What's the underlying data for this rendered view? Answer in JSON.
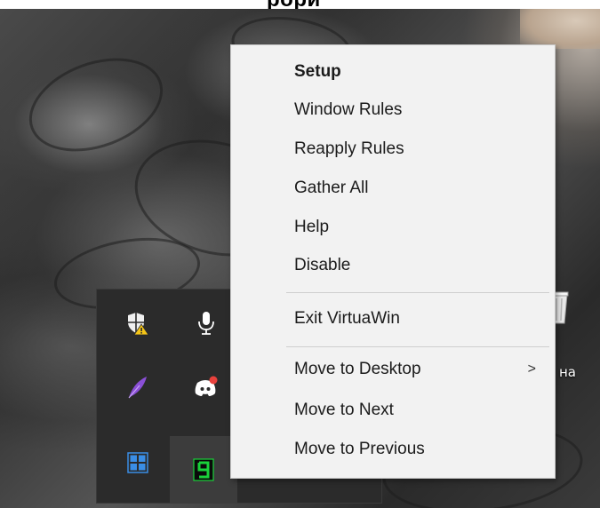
{
  "header": {
    "title_fragment": "рори"
  },
  "menu": {
    "items": [
      {
        "label": "Setup",
        "bold": true
      },
      {
        "label": "Window Rules"
      },
      {
        "label": "Reapply Rules"
      },
      {
        "label": "Gather All"
      },
      {
        "label": "Help"
      },
      {
        "label": "Disable"
      }
    ],
    "exit_label": "Exit VirtuaWin",
    "move_items": [
      {
        "label": "Move to Desktop",
        "submenu_arrow": ">"
      },
      {
        "label": "Move to Next"
      },
      {
        "label": "Move to Previous"
      }
    ]
  },
  "desktop": {
    "icon_label_fragment": "на",
    "icons": [
      "recycle-bin-icon"
    ]
  },
  "tray": {
    "icons": [
      {
        "name": "windows-security-warning-icon"
      },
      {
        "name": "microphone-icon"
      },
      {
        "name": "feather-icon",
        "color": "#8a4fd6"
      },
      {
        "name": "discord-notification-icon",
        "badge_color": "#e8413c"
      },
      {
        "name": "app-grid-icon",
        "color": "#3a8ee6"
      },
      {
        "name": "virtuawin-desktop-number-icon",
        "value": "9",
        "color": "#19d23a"
      }
    ]
  },
  "colors": {
    "menu_bg": "#f2f2f2",
    "menu_text": "#1b1b1b",
    "tray_bg": "#2b2b2b"
  }
}
